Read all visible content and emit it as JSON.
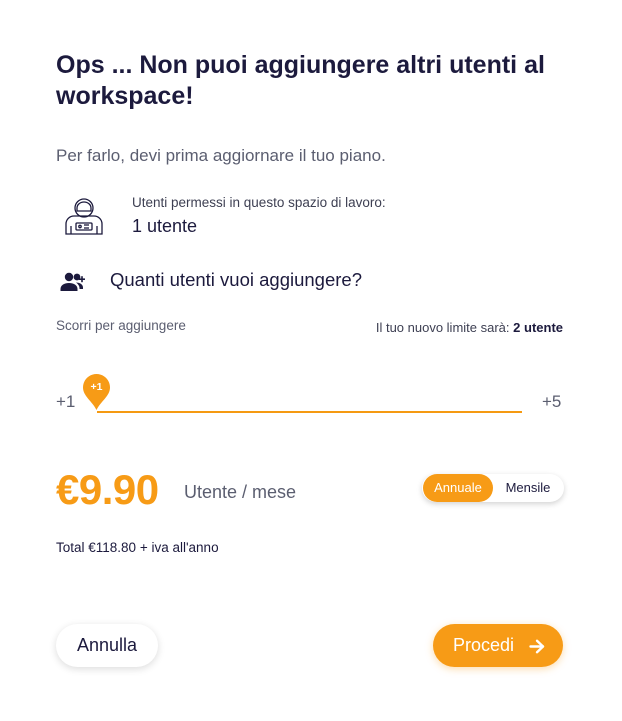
{
  "dialog": {
    "title": "Ops ... Non puoi aggiungere altri utenti al workspace!",
    "subtitle": "Per farlo, devi prima aggiornare il tuo piano."
  },
  "allowed": {
    "label": "Utenti permessi in questo spazio di lavoro:",
    "value": "1 utente",
    "icon": "astronaut-icon"
  },
  "question": {
    "text": "Quanti utenti vuoi aggiungere?",
    "icon": "add-user-icon"
  },
  "slider": {
    "hint": "Scorri per aggiungere",
    "limit_prefix": "Il tuo nuovo limite sarà:",
    "limit_value": "2 utente",
    "min_label": "+1",
    "max_label": "+5",
    "thumb_label": "+1",
    "value": 1,
    "min": 1,
    "max": 5
  },
  "pricing": {
    "price": "€9.90",
    "unit": "Utente / mese",
    "toggle_annual": "Annuale",
    "toggle_monthly": "Mensile",
    "selected": "Annuale",
    "total": "Total €118.80 + iva all'anno"
  },
  "actions": {
    "cancel_label": "Annulla",
    "proceed_label": "Procedi"
  },
  "colors": {
    "accent": "#f79b16",
    "text_dark": "#1c1a3d",
    "text_muted": "#5b5e70"
  }
}
